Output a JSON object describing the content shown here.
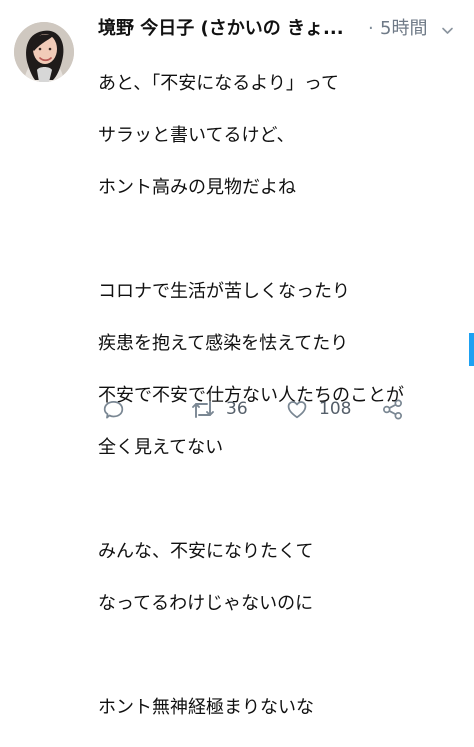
{
  "tweet": {
    "author_name": "境野 今日子 (さかいの きょ...",
    "dot": "·",
    "time": "5時間",
    "body_lines": [
      "あと、「不安になるより」って",
      "サラッと書いてるけど、",
      "ホント高みの見物だよね",
      "",
      "コロナで生活が苦しくなったり",
      "疾患を抱えて感染を怯えてたり",
      "不安で不安で仕方ない人たちのことが",
      "全く見えてない",
      "",
      "みんな、不安になりたくて",
      "なってるわけじゃないのに",
      "",
      "ホント無神経極まりないな"
    ],
    "actions": {
      "reply_icon": "reply-icon",
      "retweet_icon": "retweet-icon",
      "retweet_count": "36",
      "like_icon": "heart-icon",
      "like_count": "108",
      "share_icon": "share-icon"
    }
  },
  "colors": {
    "text": "#111111",
    "muted": "#6f7a87",
    "icon": "#7a8793",
    "accent": "#1da1f2",
    "background": "#ffffff"
  }
}
